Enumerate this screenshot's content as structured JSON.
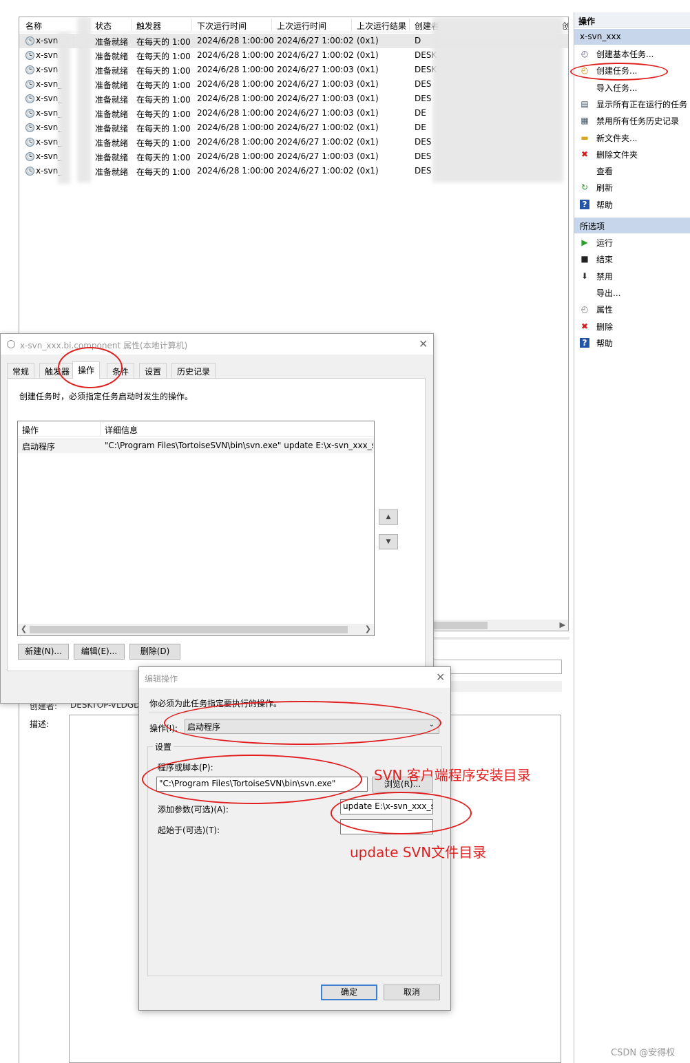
{
  "task_list": {
    "columns": [
      "名称",
      "状态",
      "触发器",
      "下次运行时间",
      "上次运行时间",
      "上次运行结果",
      "创建者",
      "创"
    ],
    "rows": [
      {
        "name": "x-svn",
        "status": "准备就绪",
        "trigger": "在每天的 1:00",
        "next_run": "2024/6/28 1:00:00",
        "last_run": "2024/6/27 1:00:02",
        "result": "(0x1)",
        "creator": "D"
      },
      {
        "name": "x-svn",
        "status": "准备就绪",
        "trigger": "在每天的 1:00",
        "next_run": "2024/6/28 1:00:00",
        "last_run": "2024/6/27 1:00:02",
        "result": "(0x1)",
        "creator": "DESK"
      },
      {
        "name": "x-svn",
        "status": "准备就绪",
        "trigger": "在每天的 1:00",
        "next_run": "2024/6/28 1:00:00",
        "last_run": "2024/6/27 1:00:03",
        "result": "(0x1)",
        "creator": "DESK"
      },
      {
        "name": "x-svn_",
        "status": "准备就绪",
        "trigger": "在每天的 1:00",
        "next_run": "2024/6/28 1:00:00",
        "last_run": "2024/6/27 1:00:03",
        "result": "(0x1)",
        "creator": "DES"
      },
      {
        "name": "x-svn_",
        "status": "准备就绪",
        "trigger": "在每天的 1:00",
        "next_run": "2024/6/28 1:00:00",
        "last_run": "2024/6/27 1:00:03",
        "result": "(0x1)",
        "creator": "DES"
      },
      {
        "name": "x-svn_",
        "status": "准备就绪",
        "trigger": "在每天的 1:00",
        "next_run": "2024/6/28 1:00:00",
        "last_run": "2024/6/27 1:00:03",
        "result": "(0x1)",
        "creator": "DE"
      },
      {
        "name": "x-svn_",
        "status": "准备就绪",
        "trigger": "在每天的 1:00",
        "next_run": "2024/6/28 1:00:00",
        "last_run": "2024/6/27 1:00:02",
        "result": "(0x1)",
        "creator": "DE"
      },
      {
        "name": "x-svn_",
        "status": "准备就绪",
        "trigger": "在每天的 1:00",
        "next_run": "2024/6/28 1:00:00",
        "last_run": "2024/6/27 1:00:02",
        "result": "(0x1)",
        "creator": "DES"
      },
      {
        "name": "x-svn_",
        "status": "准备就绪",
        "trigger": "在每天的 1:00",
        "next_run": "2024/6/28 1:00:00",
        "last_run": "2024/6/27 1:00:03",
        "result": "(0x1)",
        "creator": "DES"
      },
      {
        "name": "x-svn_",
        "status": "准备就绪",
        "trigger": "在每天的 1:00",
        "next_run": "2024/6/28 1:00:00",
        "last_run": "2024/6/27 1:00:02",
        "result": "(0x1)",
        "creator": "DES"
      }
    ]
  },
  "action_panel": {
    "header": "操作",
    "section_title": "x-svn_xxx",
    "items": [
      {
        "label": "创建基本任务...",
        "icon": "basic-task-icon"
      },
      {
        "label": "创建任务...",
        "icon": "create-task-icon"
      },
      {
        "label": "导入任务...",
        "icon": ""
      },
      {
        "label": "显示所有正在运行的任务",
        "icon": "running-tasks-icon"
      },
      {
        "label": "禁用所有任务历史记录",
        "icon": "history-icon"
      },
      {
        "label": "新文件夹...",
        "icon": "folder-icon"
      },
      {
        "label": "删除文件夹",
        "icon": "delete-icon"
      },
      {
        "label": "查看",
        "icon": ""
      },
      {
        "label": "刷新",
        "icon": "refresh-icon"
      },
      {
        "label": "帮助",
        "icon": "help-icon"
      }
    ],
    "selected_header": "所选项",
    "selected_items": [
      {
        "label": "运行",
        "icon": "run-icon"
      },
      {
        "label": "结束",
        "icon": "stop-icon"
      },
      {
        "label": "禁用",
        "icon": "disable-icon"
      },
      {
        "label": "导出...",
        "icon": ""
      },
      {
        "label": "属性",
        "icon": "properties-icon"
      },
      {
        "label": "删除",
        "icon": "delete-icon"
      },
      {
        "label": "帮助",
        "icon": "help-icon"
      }
    ]
  },
  "details": {
    "creator_label": "创建者:",
    "creator_value": "DESKTOP-VLDGD",
    "description_label": "描述:"
  },
  "properties_dialog": {
    "title": "x-svn_xxx.bi.component 属性(本地计算机)",
    "tabs": [
      "常规",
      "触发器",
      "操作",
      "条件",
      "设置",
      "历史记录"
    ],
    "active_tab": "操作",
    "instruction": "创建任务时，必须指定任务启动时发生的操作。",
    "table_headers": [
      "操作",
      "详细信息"
    ],
    "table_rows": [
      {
        "action": "启动程序",
        "detail": "\"C:\\Program Files\\TortoiseSVN\\bin\\svn.exe\" update E:\\x-svn_xxx_sd"
      }
    ],
    "buttons": {
      "new": "新建(N)...",
      "edit": "编辑(E)...",
      "delete": "删除(D)"
    }
  },
  "edit_dialog": {
    "title": "编辑操作",
    "instruction": "你必须为此任务指定要执行的操作。",
    "action_label": "操作(I):",
    "action_value": "启动程序",
    "settings_label": "设置",
    "program_label": "程序或脚本(P):",
    "program_value": "\"C:\\Program Files\\TortoiseSVN\\bin\\svn.exe\"",
    "browse_label": "浏览(R)...",
    "args_label": "添加参数(可选)(A):",
    "args_value": "update E:\\x-svn_xxx_sc",
    "start_in_label": "起始于(可选)(T):",
    "start_in_value": "",
    "ok_label": "确定",
    "cancel_label": "取消"
  },
  "annotations": {
    "svn_install": "SVN 客户端程序安装目录",
    "svn_update": "update SVN文件目录",
    "color": "#e02020"
  },
  "watermark": "CSDN @安得权"
}
